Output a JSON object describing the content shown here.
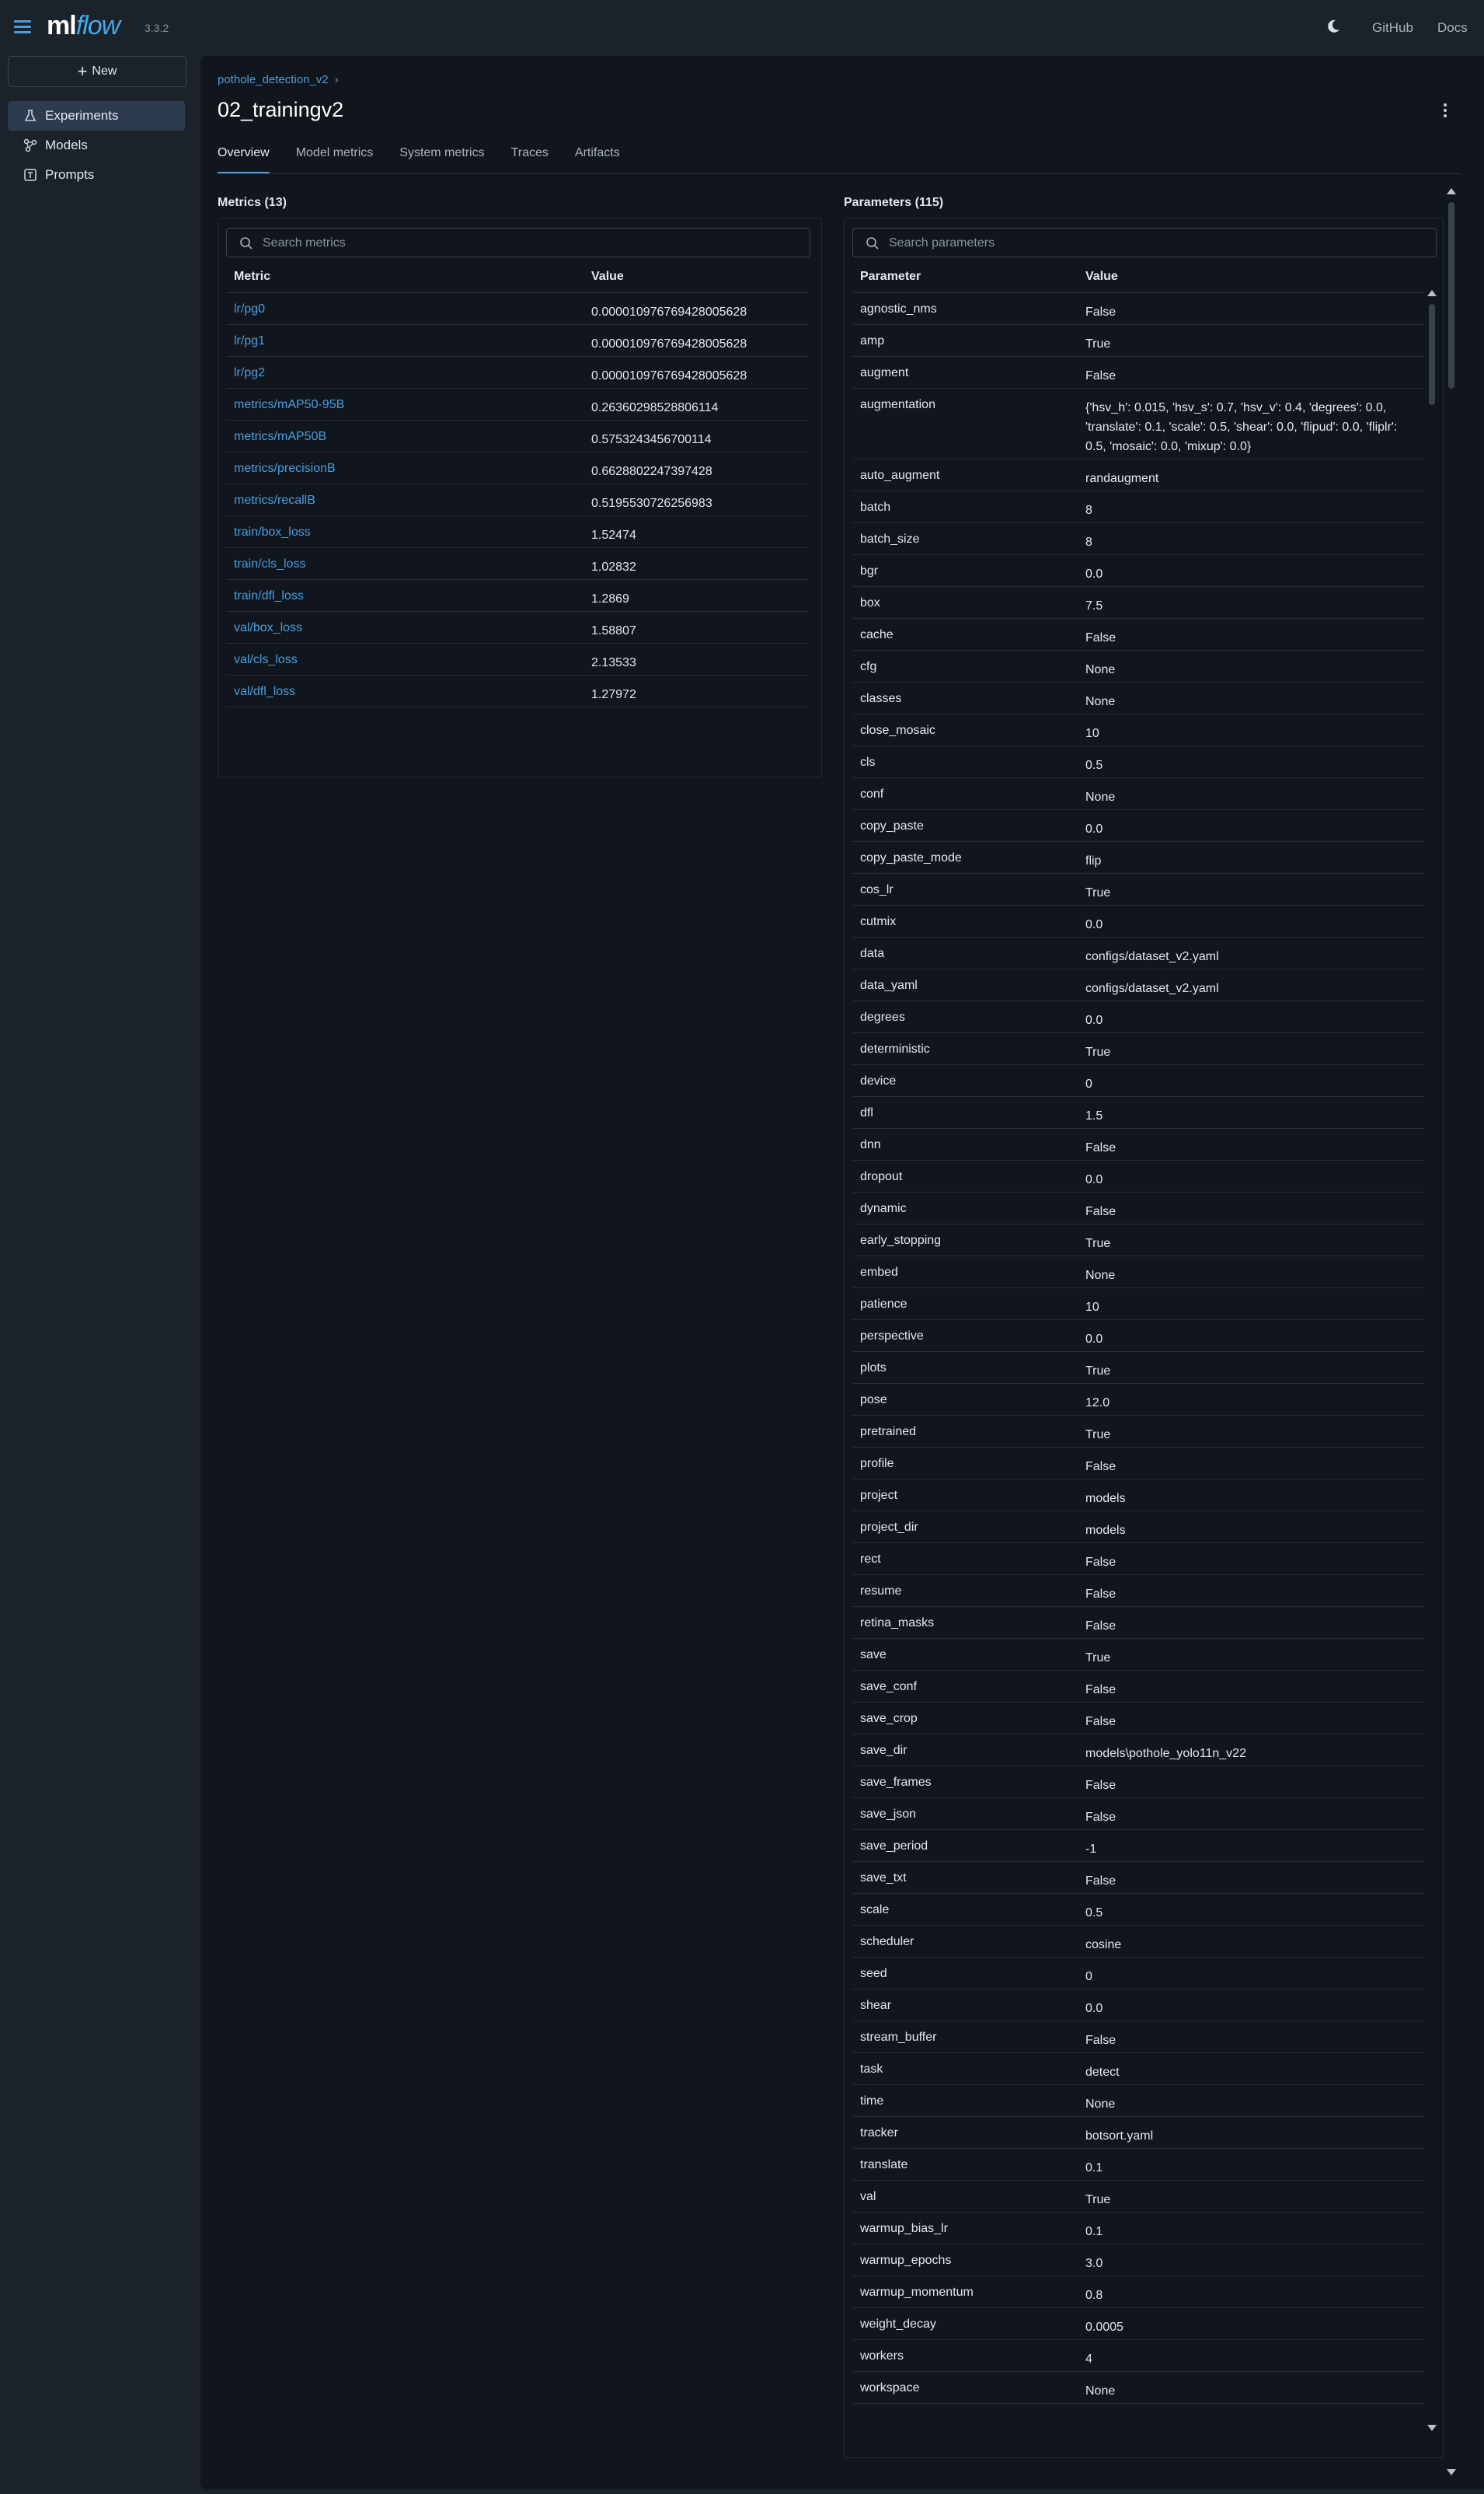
{
  "app": {
    "logo_ml": "ml",
    "logo_flow": "flow",
    "version": "3.3.2"
  },
  "header": {
    "github": "GitHub",
    "docs": "Docs"
  },
  "sidebar": {
    "new_label": "New",
    "items": [
      {
        "label": "Experiments",
        "icon": "flask-icon",
        "active": true
      },
      {
        "label": "Models",
        "icon": "models-icon",
        "active": false
      },
      {
        "label": "Prompts",
        "icon": "prompts-icon",
        "active": false
      }
    ]
  },
  "breadcrumb": {
    "experiment": "pothole_detection_v2",
    "separator": "›"
  },
  "run": {
    "title": "02_trainingv2"
  },
  "tabs": [
    "Overview",
    "Model metrics",
    "System metrics",
    "Traces",
    "Artifacts"
  ],
  "metrics": {
    "title": "Metrics (13)",
    "search_placeholder": "Search metrics",
    "columns": [
      "Metric",
      "Value"
    ],
    "rows": [
      [
        "lr/pg0",
        "0.000010976769428005628"
      ],
      [
        "lr/pg1",
        "0.000010976769428005628"
      ],
      [
        "lr/pg2",
        "0.000010976769428005628"
      ],
      [
        "metrics/mAP50-95B",
        "0.26360298528806114"
      ],
      [
        "metrics/mAP50B",
        "0.5753243456700114"
      ],
      [
        "metrics/precisionB",
        "0.6628802247397428"
      ],
      [
        "metrics/recallB",
        "0.5195530726256983"
      ],
      [
        "train/box_loss",
        "1.52474"
      ],
      [
        "train/cls_loss",
        "1.02832"
      ],
      [
        "train/dfl_loss",
        "1.2869"
      ],
      [
        "val/box_loss",
        "1.58807"
      ],
      [
        "val/cls_loss",
        "2.13533"
      ],
      [
        "val/dfl_loss",
        "1.27972"
      ]
    ]
  },
  "parameters": {
    "title": "Parameters (115)",
    "search_placeholder": "Search parameters",
    "columns": [
      "Parameter",
      "Value"
    ],
    "rows": [
      [
        "agnostic_nms",
        "False"
      ],
      [
        "amp",
        "True"
      ],
      [
        "augment",
        "False"
      ],
      [
        "augmentation",
        "{'hsv_h': 0.015, 'hsv_s': 0.7, 'hsv_v': 0.4, 'degrees': 0.0, 'translate': 0.1, 'scale': 0.5, 'shear': 0.0, 'flipud': 0.0, 'fliplr': 0.5, 'mosaic': 0.0, 'mixup': 0.0}"
      ],
      [
        "auto_augment",
        "randaugment"
      ],
      [
        "batch",
        "8"
      ],
      [
        "batch_size",
        "8"
      ],
      [
        "bgr",
        "0.0"
      ],
      [
        "box",
        "7.5"
      ],
      [
        "cache",
        "False"
      ],
      [
        "cfg",
        "None"
      ],
      [
        "classes",
        "None"
      ],
      [
        "close_mosaic",
        "10"
      ],
      [
        "cls",
        "0.5"
      ],
      [
        "conf",
        "None"
      ],
      [
        "copy_paste",
        "0.0"
      ],
      [
        "copy_paste_mode",
        "flip"
      ],
      [
        "cos_lr",
        "True"
      ],
      [
        "cutmix",
        "0.0"
      ],
      [
        "data",
        "configs/dataset_v2.yaml"
      ],
      [
        "data_yaml",
        "configs/dataset_v2.yaml"
      ],
      [
        "degrees",
        "0.0"
      ],
      [
        "deterministic",
        "True"
      ],
      [
        "device",
        "0"
      ],
      [
        "dfl",
        "1.5"
      ],
      [
        "dnn",
        "False"
      ],
      [
        "dropout",
        "0.0"
      ],
      [
        "dynamic",
        "False"
      ],
      [
        "early_stopping",
        "True"
      ],
      [
        "embed",
        "None"
      ],
      [
        "patience",
        "10"
      ],
      [
        "perspective",
        "0.0"
      ],
      [
        "plots",
        "True"
      ],
      [
        "pose",
        "12.0"
      ],
      [
        "pretrained",
        "True"
      ],
      [
        "profile",
        "False"
      ],
      [
        "project",
        "models"
      ],
      [
        "project_dir",
        "models"
      ],
      [
        "rect",
        "False"
      ],
      [
        "resume",
        "False"
      ],
      [
        "retina_masks",
        "False"
      ],
      [
        "save",
        "True"
      ],
      [
        "save_conf",
        "False"
      ],
      [
        "save_crop",
        "False"
      ],
      [
        "save_dir",
        "models\\pothole_yolo11n_v22"
      ],
      [
        "save_frames",
        "False"
      ],
      [
        "save_json",
        "False"
      ],
      [
        "save_period",
        "-1"
      ],
      [
        "save_txt",
        "False"
      ],
      [
        "scale",
        "0.5"
      ],
      [
        "scheduler",
        "cosine"
      ],
      [
        "seed",
        "0"
      ],
      [
        "shear",
        "0.0"
      ],
      [
        "stream_buffer",
        "False"
      ],
      [
        "task",
        "detect"
      ],
      [
        "time",
        "None"
      ],
      [
        "tracker",
        "botsort.yaml"
      ],
      [
        "translate",
        "0.1"
      ],
      [
        "val",
        "True"
      ],
      [
        "warmup_bias_lr",
        "0.1"
      ],
      [
        "warmup_epochs",
        "3.0"
      ],
      [
        "warmup_momentum",
        "0.8"
      ],
      [
        "weight_decay",
        "0.0005"
      ],
      [
        "workers",
        "4"
      ],
      [
        "workspace",
        "None"
      ]
    ]
  },
  "colors": {
    "accent": "#4a9de0",
    "background": "#11161c",
    "sidebar": "#1c2229"
  }
}
